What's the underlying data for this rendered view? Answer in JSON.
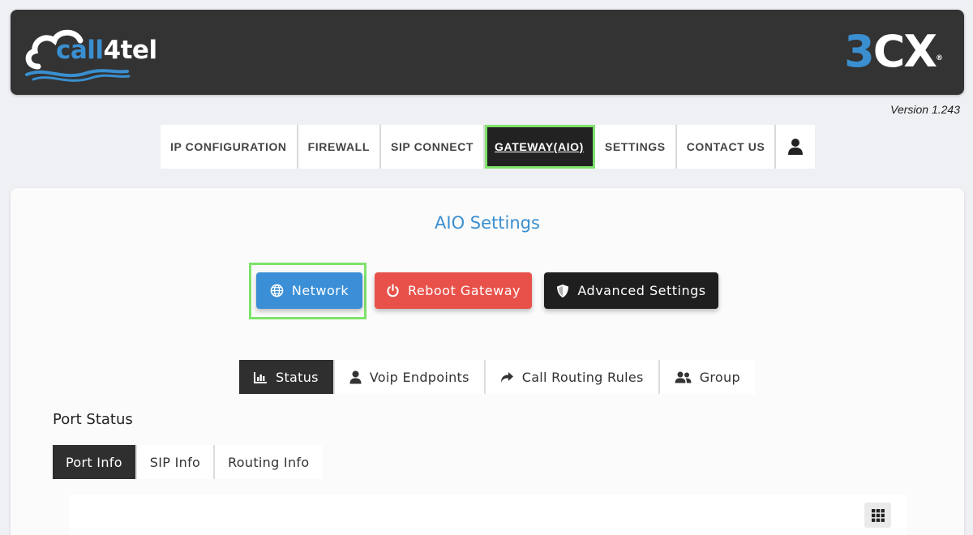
{
  "header": {
    "brand_left_part1": "call",
    "brand_left_part2": "4tel",
    "brand_right_part1": "3",
    "brand_right_part2": "CX",
    "brand_right_reg": "®"
  },
  "version": "Version 1.243",
  "topnav": {
    "items": [
      {
        "label": "IP CONFIGURATION"
      },
      {
        "label": "FIREWALL"
      },
      {
        "label": "SIP CONNECT"
      },
      {
        "label": "GATEWAY(AIO)",
        "active": true
      },
      {
        "label": "SETTINGS"
      },
      {
        "label": "CONTACT US"
      }
    ],
    "user_icon": "user-icon"
  },
  "main": {
    "title": "AIO Settings",
    "actions": {
      "network": {
        "label": "Network",
        "icon": "globe-icon"
      },
      "reboot": {
        "label": "Reboot Gateway",
        "icon": "power-icon"
      },
      "advanced": {
        "label": "Advanced Settings",
        "icon": "shield-icon"
      }
    },
    "subtabs": [
      {
        "label": "Status",
        "icon": "bar-chart-icon",
        "active": true
      },
      {
        "label": "Voip Endpoints",
        "icon": "user-icon"
      },
      {
        "label": "Call Routing Rules",
        "icon": "share-arrow-icon"
      },
      {
        "label": "Group",
        "icon": "users-icon"
      }
    ],
    "section_title": "Port Status",
    "infotabs": [
      {
        "label": "Port Info",
        "active": true
      },
      {
        "label": "SIP Info"
      },
      {
        "label": "Routing Info"
      }
    ],
    "grid_icon": "grid-icon"
  },
  "colors": {
    "accent_blue": "#3b8fd6",
    "danger_red": "#e8514a",
    "dark": "#1f1f1f",
    "highlight_green": "#7ee36a",
    "header_bg": "#333333"
  }
}
